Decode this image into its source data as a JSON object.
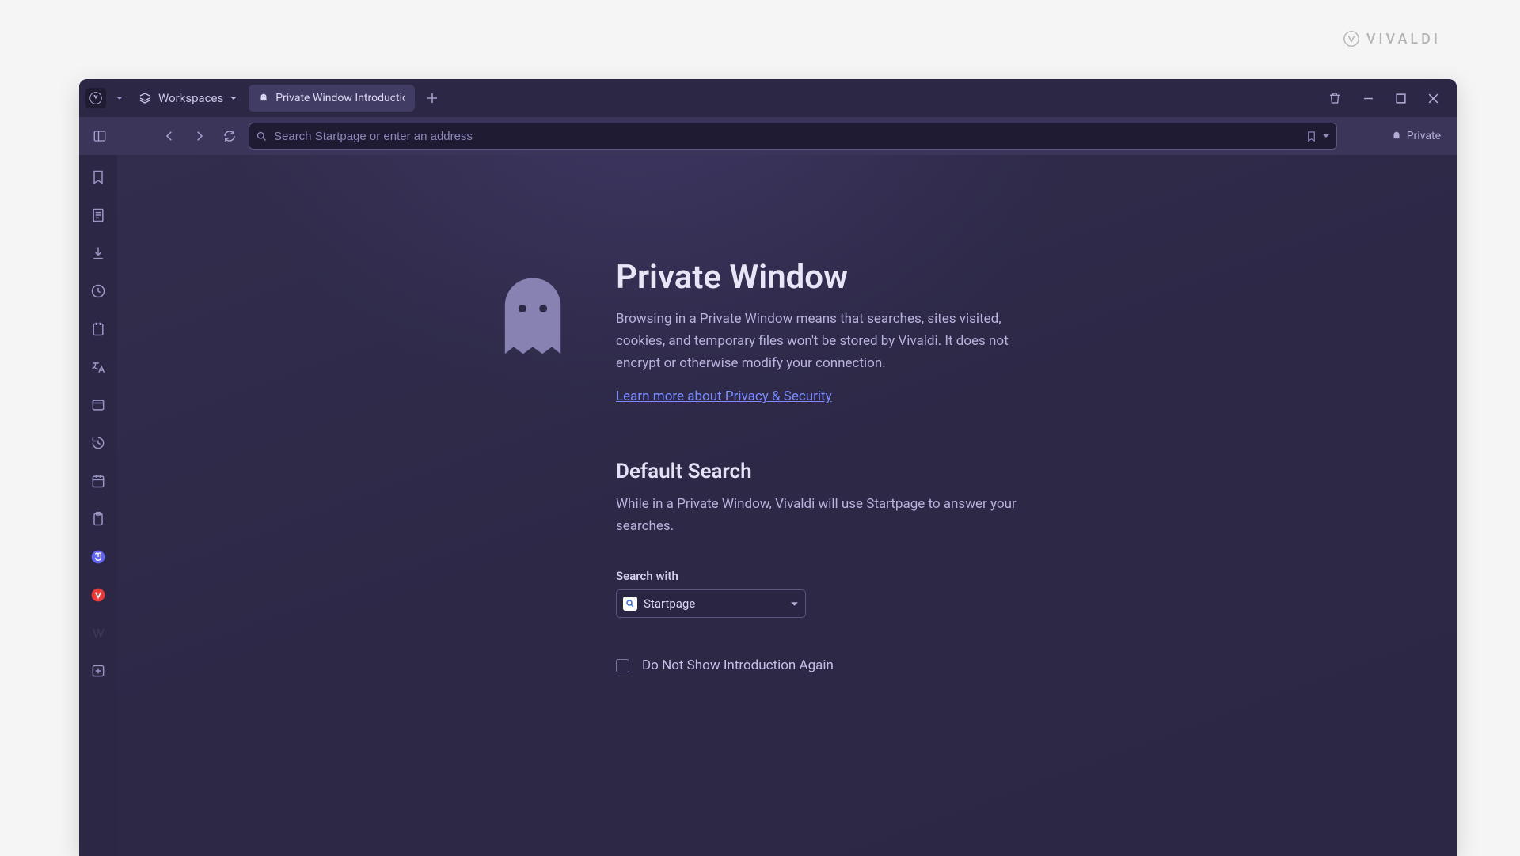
{
  "brand": "VIVALDI",
  "tabstrip": {
    "workspaces_label": "Workspaces",
    "tab_title": "Private Window Introductio",
    "address_placeholder": "Search Startpage or enter an address",
    "private_label": "Private"
  },
  "page": {
    "title": "Private Window",
    "description": "Browsing in a Private Window means that searches, sites visited, cookies, and temporary files won't be stored by Vivaldi. It does not encrypt or otherwise modify your connection.",
    "learn_more": "Learn more about Privacy & Security",
    "default_search_title": "Default Search",
    "default_search_desc": "While in a Private Window, Vivaldi will use Startpage to answer your searches.",
    "search_with_label": "Search with",
    "search_engine": "Startpage",
    "checkbox_label": "Do Not Show Introduction Again"
  }
}
